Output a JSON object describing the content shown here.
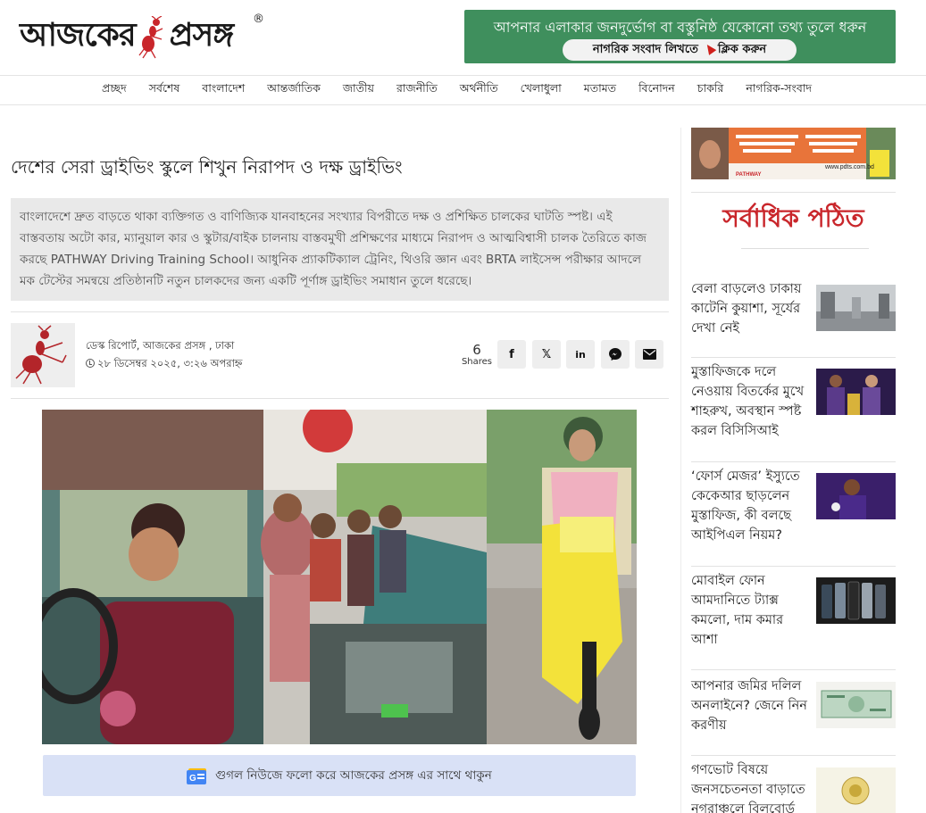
{
  "site": {
    "logo_text_1": "আজকের",
    "logo_text_2": "প্রসঙ্গ",
    "registered_mark": "®"
  },
  "banner": {
    "text": "আপনার এলাকার জনদুর্ভোগ বা বস্তুনিষ্ঠ যেকোনো তথ্য তুলে ধরুন",
    "button_left": "নাগরিক সংবাদ লিখতে",
    "button_right": "ক্লিক করুন"
  },
  "nav": {
    "items": [
      "প্রচ্ছদ",
      "সর্বশেষ",
      "বাংলাদেশ",
      "আন্তর্জাতিক",
      "জাতীয়",
      "রাজনীতি",
      "অর্থনীতি",
      "খেলাধুলা",
      "মতামত",
      "বিনোদন",
      "চাকরি",
      "নাগরিক-সংবাদ"
    ]
  },
  "article": {
    "headline": "দেশের সেরা ড্রাইভিং স্কুলে শিখুন নিরাপদ ও দক্ষ ড্রাইভিং",
    "summary": "বাংলাদেশে দ্রুত বাড়তে থাকা ব্যক্তিগত ও বাণিজ্যিক যানবাহনের সংখ্যার বিপরীতে দক্ষ ও প্রশিক্ষিত চালকের ঘাটতি স্পষ্ট। এই বাস্তবতায় অটো কার, ম্যানুয়াল কার ও স্কুটার/বাইক চালনায় বাস্তবমুখী প্রশিক্ষণের মাধ্যমে নিরাপদ ও আত্মবিশ্বাসী চালক তৈরিতে কাজ করছে PATHWAY Driving Training School। আধুনিক প্র্যাকটিক্যাল ট্রেনিং, থিওরি জ্ঞান এবং BRTA লাইসেন্স পরীক্ষার আদলে মক টেস্টের সমন্বয়ে প্রতিষ্ঠানটি নতুন চালকদের জন্য একটি পূর্ণাঙ্গ ড্রাইভিং সমাধান তুলে ধরেছে।",
    "author": "ডেস্ক রিপোর্ট, আজকের প্রসঙ্গ , ঢাকা",
    "date": "২৮ ডিসেম্বর ২০২৫, ৩:২৬ অপরাহ্ন",
    "shares_count": "6",
    "shares_label": "Shares",
    "share_buttons": [
      {
        "icon": "facebook-icon",
        "glyph": "f"
      },
      {
        "icon": "x-icon",
        "glyph": "𝕏"
      },
      {
        "icon": "linkedin-icon",
        "glyph": "in"
      },
      {
        "icon": "messenger-icon",
        "glyph": "m"
      },
      {
        "icon": "email-icon",
        "glyph": "✉"
      }
    ],
    "google_news_text": "গুগল নিউজে ফলো করে আজকের প্রসঙ্গ এর সাথে থাকুন",
    "google_news_icon_label": "G"
  },
  "sidebar": {
    "ad_url": "www.pdts.com.bd",
    "ad_brand": "PATHWAY",
    "popular_title": "সর্বাধিক পঠিত",
    "news": [
      {
        "title": "বেলা বাড়লেও ঢাকায় কাটেনি কুয়াশা, সূর্যের দেখা নেই"
      },
      {
        "title": "মুস্তাফিজকে দলে নেওয়ায় বিতর্কের মুখে শাহরুখ, অবস্থান স্পষ্ট করল বিসিসিআই"
      },
      {
        "title": "‘ফোর্স মেজর’ ইস্যুতে কেকেআর ছাড়লেন মুস্তাফিজ, কী বলছে আইপিএল নিয়ম?"
      },
      {
        "title": "মোবাইল ফোন আমদানিতে ট্যাক্স কমলো, দাম কমার আশা"
      },
      {
        "title": "আপনার জমির দলিল অনলাইনে? জেনে নিন করণীয়"
      },
      {
        "title": "গণভোট বিষয়ে জনসচেতনতা বাড়াতে নগরাঞ্চলে বিলবোর্ড"
      }
    ]
  },
  "colors": {
    "brand_red": "#c9262b",
    "banner_green": "#3f8f5d",
    "gnews_bg": "#d9e1f6",
    "summary_bg": "#e9e9e9"
  }
}
